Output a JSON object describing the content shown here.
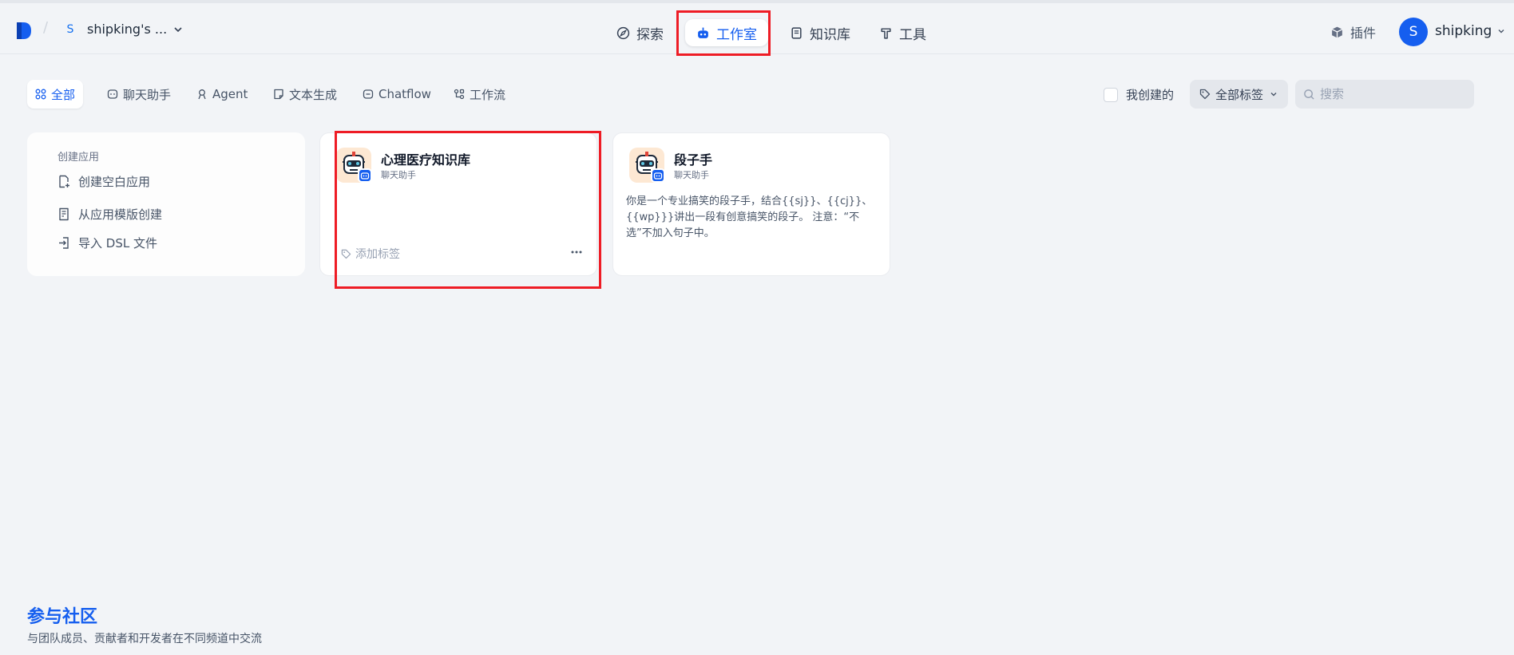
{
  "header": {
    "workspace_initial": "S",
    "workspace_name": "shipking's ...",
    "nav": [
      {
        "label": "探索",
        "icon": "compass-icon"
      },
      {
        "label": "工作室",
        "icon": "robot-icon",
        "active": true
      },
      {
        "label": "知识库",
        "icon": "book-icon"
      },
      {
        "label": "工具",
        "icon": "hammer-icon"
      }
    ],
    "plugin_label": "插件",
    "user_initial": "S",
    "user_name": "shipking"
  },
  "filters": {
    "tabs": [
      {
        "label": "全部",
        "active": true
      },
      {
        "label": "聊天助手"
      },
      {
        "label": "Agent"
      },
      {
        "label": "文本生成"
      },
      {
        "label": "Chatflow"
      },
      {
        "label": "工作流"
      }
    ],
    "mine_label": "我创建的",
    "mine_checked": false,
    "tags_label": "全部标签",
    "search_placeholder": "搜索"
  },
  "create": {
    "title": "创建应用",
    "items": [
      "创建空白应用",
      "从应用模版创建",
      "导入 DSL 文件"
    ]
  },
  "apps": [
    {
      "name": "心理医疗知识库",
      "type": "聊天助手",
      "description": "",
      "tag_placeholder": "添加标签"
    },
    {
      "name": "段子手",
      "type": "聊天助手",
      "description": "你是一个专业搞笑的段子手，结合{{sj}}、{{cj}}、{{wp}}}讲出一段有创意搞笑的段子。 注意：“不选”不加入句子中。"
    }
  ],
  "footer": {
    "community_title": "参与社区",
    "community_desc": "与团队成员、贡献者和开发者在不同频道中交流"
  },
  "colors": {
    "accent": "#155eef",
    "background": "#f2f4f7",
    "highlight_box": "#ee1c25"
  }
}
